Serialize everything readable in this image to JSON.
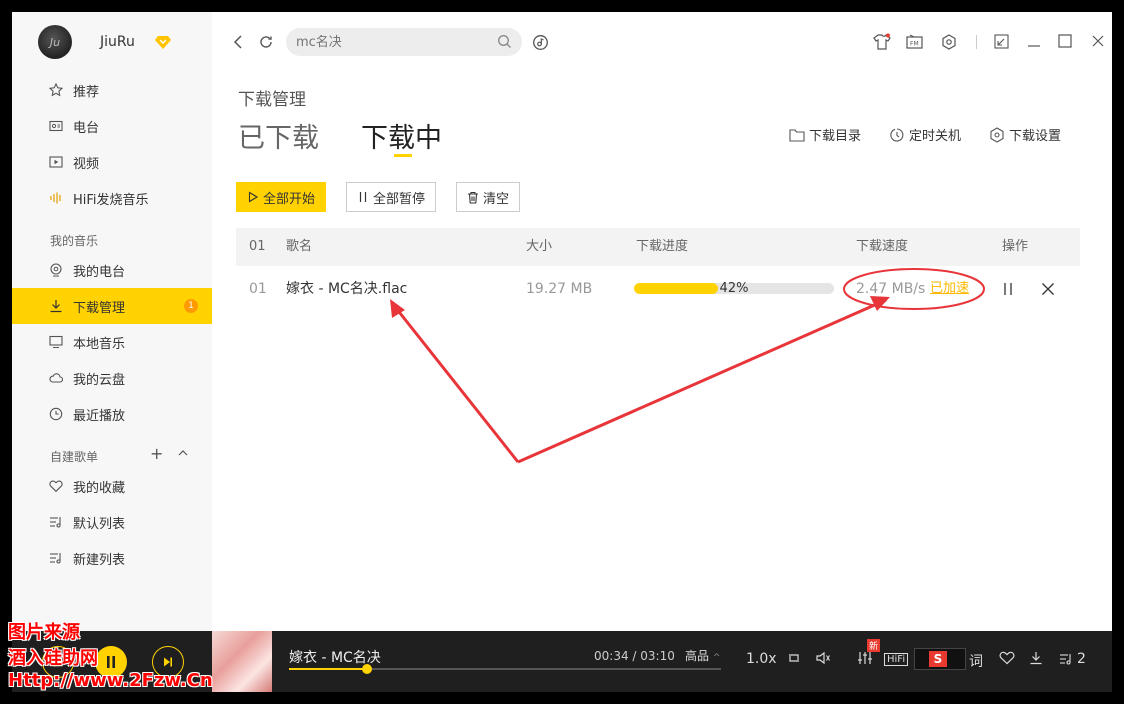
{
  "user": {
    "name": "JiuRu",
    "avatar_text": "Ju"
  },
  "sidebar": {
    "top_items": [
      {
        "label": "推荐",
        "icon": "star-icon"
      },
      {
        "label": "电台",
        "icon": "radio-icon"
      },
      {
        "label": "视频",
        "icon": "video-icon"
      },
      {
        "label": "HiFi发烧音乐",
        "icon": "hifi-icon"
      }
    ],
    "my_music_title": "我的音乐",
    "my_music_items": [
      {
        "label": "我的电台",
        "icon": "my-radio-icon"
      },
      {
        "label": "下载管理",
        "icon": "download-icon",
        "badge": "1",
        "active": true
      },
      {
        "label": "本地音乐",
        "icon": "monitor-icon"
      },
      {
        "label": "我的云盘",
        "icon": "cloud-icon"
      },
      {
        "label": "最近播放",
        "icon": "clock-icon"
      }
    ],
    "playlist_title": "自建歌单",
    "playlist_items": [
      {
        "label": "我的收藏",
        "icon": "heart-icon"
      },
      {
        "label": "默认列表",
        "icon": "list-icon"
      },
      {
        "label": "新建列表",
        "icon": "list-icon"
      }
    ]
  },
  "topbar": {
    "search_placeholder": "mc名决"
  },
  "main": {
    "breadcrumb": "下载管理",
    "tabs": [
      {
        "label": "已下载"
      },
      {
        "label": "下载中",
        "active": true
      }
    ],
    "tools": [
      "下载目录",
      "定时关机",
      "下载设置"
    ],
    "buttons": {
      "start_all": "全部开始",
      "pause_all": "全部暂停",
      "clear": "清空"
    },
    "table": {
      "headers": {
        "index": "01",
        "name": "歌名",
        "size": "大小",
        "progress": "下载进度",
        "speed": "下载速度",
        "action": "操作"
      },
      "rows": [
        {
          "index": "01",
          "name": "嫁衣 - MC名决.flac",
          "size": "19.27 MB",
          "progress": 0.42,
          "progress_text": "42%",
          "speed": "2.47 MB/s",
          "accel": "已加速"
        }
      ]
    }
  },
  "player": {
    "title": "嫁衣 - MC名决",
    "time": "00:34 / 03:10",
    "quality": "高品",
    "progress": 0.18,
    "speed": "1.0x",
    "new_badge": "新",
    "hifi": "HiFi",
    "lyric": "词",
    "playlist_count": "2"
  },
  "watermark": {
    "line1": "图片来源",
    "line2": "酒入硅助网",
    "line3": "Http://www.2Fzw.Cn"
  },
  "colors": {
    "accent": "#ffd200",
    "annotation": "#e8353a",
    "badge": "#ff9b00"
  }
}
